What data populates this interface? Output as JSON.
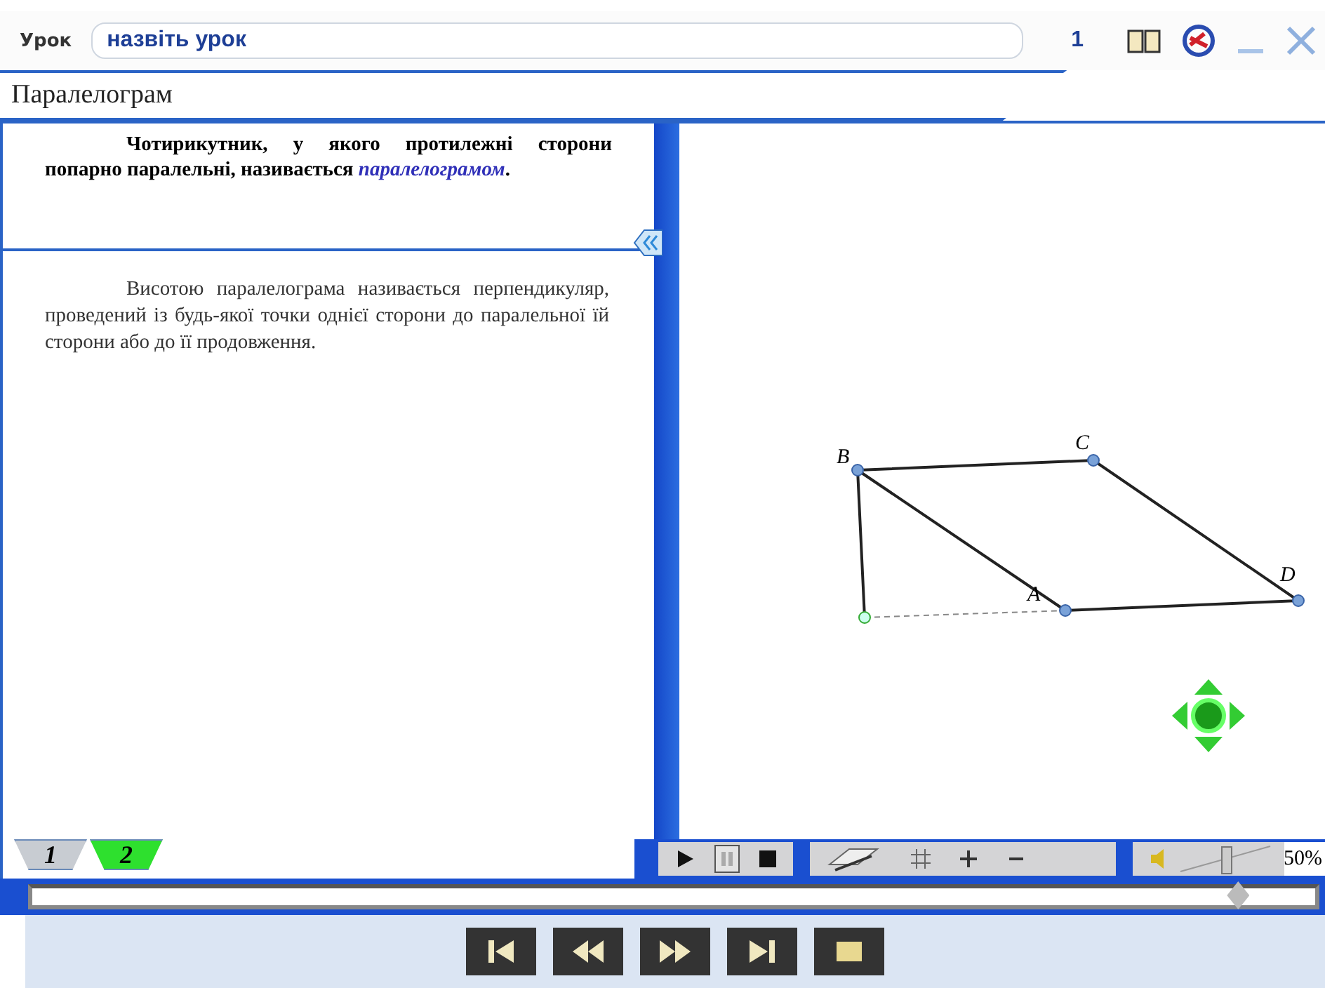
{
  "header": {
    "lesson_label": "Урок",
    "lesson_field": {
      "value": "назвіть урок"
    },
    "page_number": "1"
  },
  "title": "Паралелограм",
  "definition": "Чотирикутник, у якого протилежні сторони попарно паралельні, називається *паралелограмом*.",
  "note": "Висотою паралелограма називається перпендикуляр, проведений із будь-якої точки однієї сторони до паралельної їй сторони або до її продовження.",
  "diagram": {
    "points": [
      {
        "label": "B"
      },
      {
        "label": "C"
      },
      {
        "label": "A"
      },
      {
        "label": "D"
      }
    ]
  },
  "tabs": [
    {
      "label": "1",
      "selected": false
    },
    {
      "label": "2",
      "selected": true
    }
  ],
  "zoom": "50%",
  "volume": {
    "level": 0.5
  },
  "progress": {
    "level": 0.94
  }
}
